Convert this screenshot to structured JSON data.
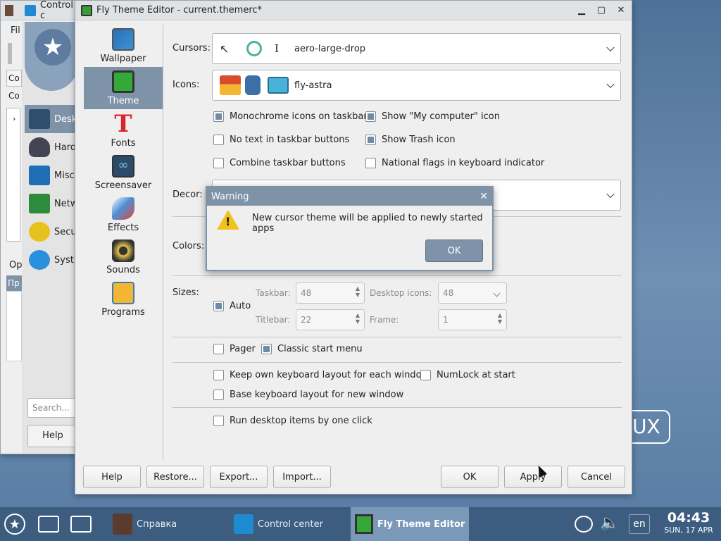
{
  "desktop": {
    "logo_text": "UX"
  },
  "control_center": {
    "title": "Control c",
    "menu_file": "Fil",
    "tab_1": "Co",
    "tab_2": "Co",
    "items": [
      "Desk",
      "Hard",
      "Misc",
      "Netw",
      "Secu",
      "Syst"
    ],
    "op_label": "Op",
    "pr_label": "Пр",
    "search_placeholder": "Search...",
    "help_label": "Help"
  },
  "theme_editor": {
    "title": "Fly Theme Editor - current.themerc*",
    "nav": [
      {
        "label": "Wallpaper",
        "icon": "wallpaper-icon"
      },
      {
        "label": "Theme",
        "icon": "theme-icon"
      },
      {
        "label": "Fonts",
        "icon": "fonts-icon"
      },
      {
        "label": "Screensaver",
        "icon": "screensaver-icon"
      },
      {
        "label": "Effects",
        "icon": "effects-icon"
      },
      {
        "label": "Sounds",
        "icon": "sounds-icon"
      },
      {
        "label": "Programs",
        "icon": "programs-icon"
      }
    ],
    "cursors_label": "Cursors:",
    "cursors_value": "aero-large-drop",
    "icons_label": "Icons:",
    "icons_value": "fly-astra",
    "checks": {
      "monochrome": "Monochrome icons on taskbar",
      "my_computer": "Show \"My computer\" icon",
      "no_text": "No text in taskbar buttons",
      "trash": "Show Trash icon",
      "combine": "Combine taskbar buttons",
      "flags": "National flags in keyboard indicator",
      "pager": "Pager",
      "classic_menu": "Classic start menu",
      "own_layout": "Keep own keyboard layout for each window",
      "numlock": "NumLock at start",
      "base_layout": "Base keyboard layout for new window",
      "one_click": "Run desktop items by one click"
    },
    "decor_label": "Decor:",
    "colors_label": "Colors:",
    "sizes_label": "Sizes:",
    "auto_label": "Auto",
    "taskbar_label": "Taskbar:",
    "taskbar_value": "48",
    "desktop_icons_label": "Desktop  icons:",
    "desktop_icons_value": "48",
    "titlebar_label": "Titlebar:",
    "titlebar_value": "22",
    "frame_label": "Frame:",
    "frame_value": "1",
    "buttons": {
      "help": "Help",
      "restore": "Restore...",
      "export": "Export...",
      "import": "Import...",
      "ok": "OK",
      "apply": "Apply",
      "cancel": "Cancel"
    }
  },
  "warning": {
    "title": "Warning",
    "message": "New cursor theme will be applied to newly started apps",
    "ok": "OK"
  },
  "taskbar": {
    "tasks": [
      "Справка",
      "Control center",
      "Fly Theme Editor"
    ],
    "lang": "en",
    "time": "04:43",
    "date": "SUN, 17 APR"
  },
  "colors": {
    "accent": "#7e93a8",
    "taskbar": "#3c5d80"
  }
}
